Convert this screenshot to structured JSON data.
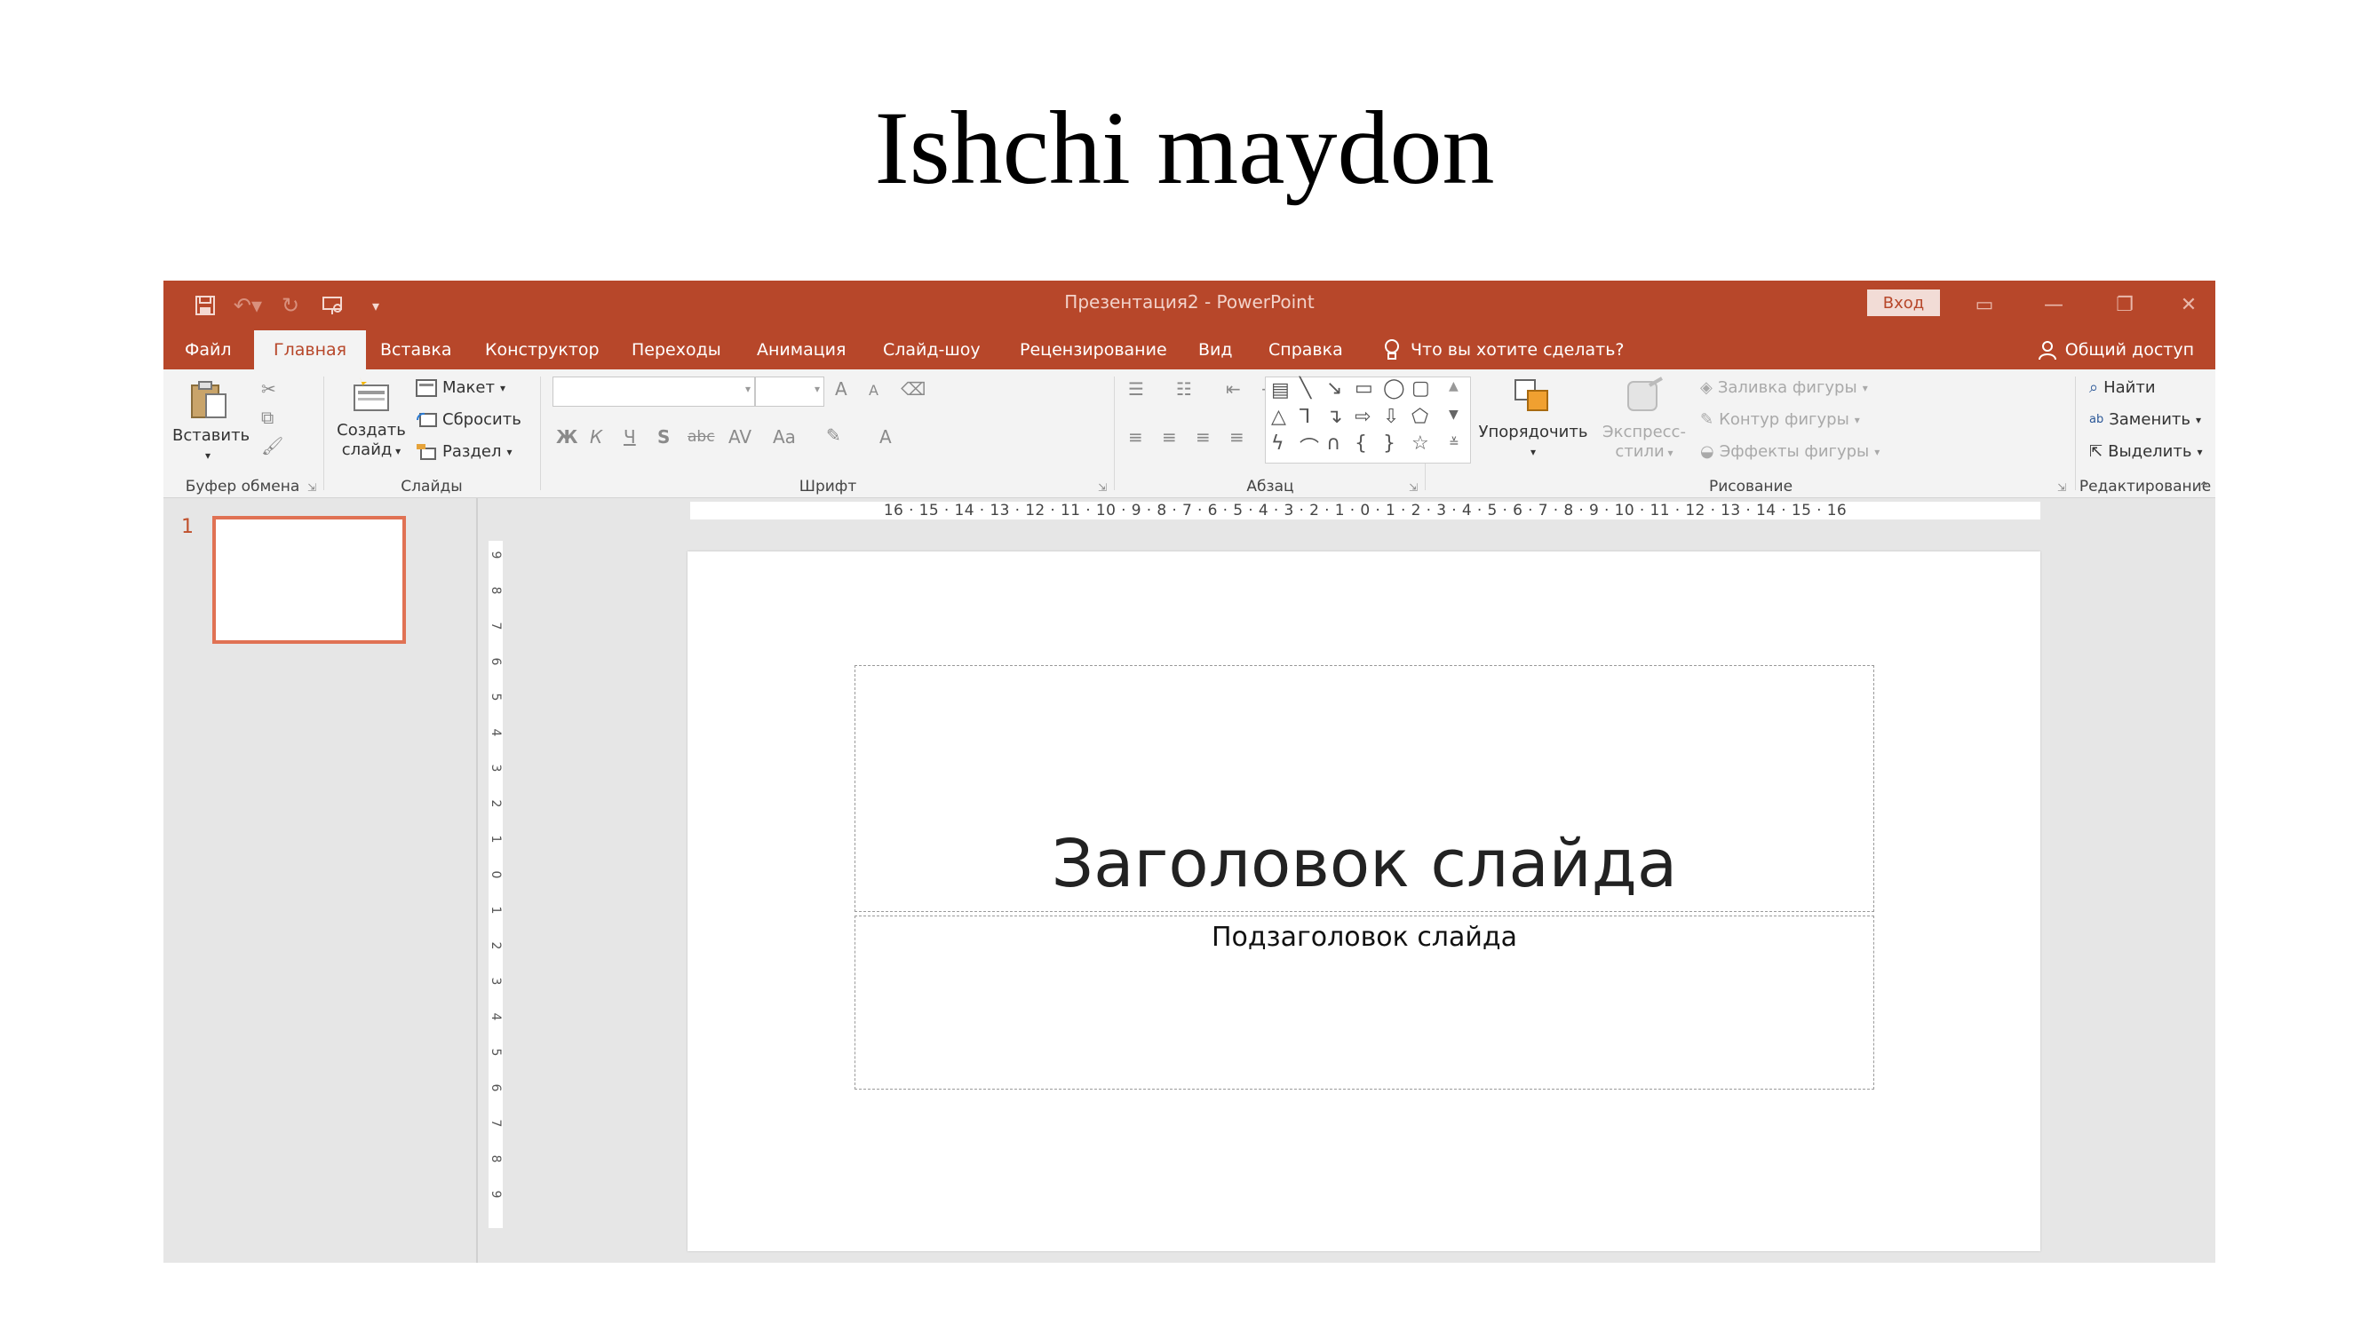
{
  "page": {
    "title": "Ishchi maydon"
  },
  "window": {
    "title": "Презентация2  -  PowerPoint",
    "signin": "Вход"
  },
  "tabs": [
    {
      "label": "Файл"
    },
    {
      "label": "Главная"
    },
    {
      "label": "Вставка"
    },
    {
      "label": "Конструктор"
    },
    {
      "label": "Переходы"
    },
    {
      "label": "Анимация"
    },
    {
      "label": "Слайд-шоу"
    },
    {
      "label": "Рецензирование"
    },
    {
      "label": "Вид"
    },
    {
      "label": "Справка"
    }
  ],
  "tell_me": "Что вы хотите сделать?",
  "share": "Общий доступ",
  "ribbon": {
    "clipboard": {
      "label": "Буфер обмена",
      "paste": "Вставить"
    },
    "slides": {
      "label": "Слайды",
      "new_slide_line1": "Создать",
      "new_slide_line2": "слайд",
      "layout": "Макет",
      "reset": "Сбросить",
      "section": "Раздел"
    },
    "font": {
      "label": "Шрифт",
      "grow": "A",
      "shrink": "A",
      "bold": "Ж",
      "italic": "К",
      "underline": "Ч",
      "shadow": "S",
      "strike": "abc",
      "spacing": "AV",
      "case": "Aa",
      "color": "A"
    },
    "paragraph": {
      "label": "Абзац"
    },
    "drawing": {
      "label": "Рисование",
      "arrange": "Упорядочить",
      "quick_styles_line1": "Экспресс-",
      "quick_styles_line2": "стили",
      "fill": "Заливка фигуры",
      "outline": "Контур фигуры",
      "effects": "Эффекты фигуры"
    },
    "editing": {
      "label": "Редактирование",
      "find": "Найти",
      "replace": "Заменить",
      "select": "Выделить"
    }
  },
  "thumbnails": [
    {
      "number": "1"
    }
  ],
  "ruler": {
    "horizontal": "16 · 15 · 14 · 13 · 12 · 11 · 10 · 9 · 8 · 7 · 6 · 5 · 4 · 3 · 2 · 1 · 0 · 1 · 2 · 3 · 4 · 5 · 6 · 7 · 8 · 9 · 10 · 11 · 12 · 13 · 14 · 15 · 16",
    "vertical": [
      "9",
      "8",
      "7",
      "6",
      "5",
      "4",
      "3",
      "2",
      "1",
      "0",
      "1",
      "2",
      "3",
      "4",
      "5",
      "6",
      "7",
      "8",
      "9"
    ]
  },
  "slide": {
    "title": "Заголовок слайда",
    "subtitle": "Подзаголовок слайда"
  },
  "colors": {
    "accent": "#b7472a",
    "thumb_border": "#e07254",
    "ribbon_bg": "#f3f3f3",
    "workspace_bg": "#e6e6e6"
  }
}
